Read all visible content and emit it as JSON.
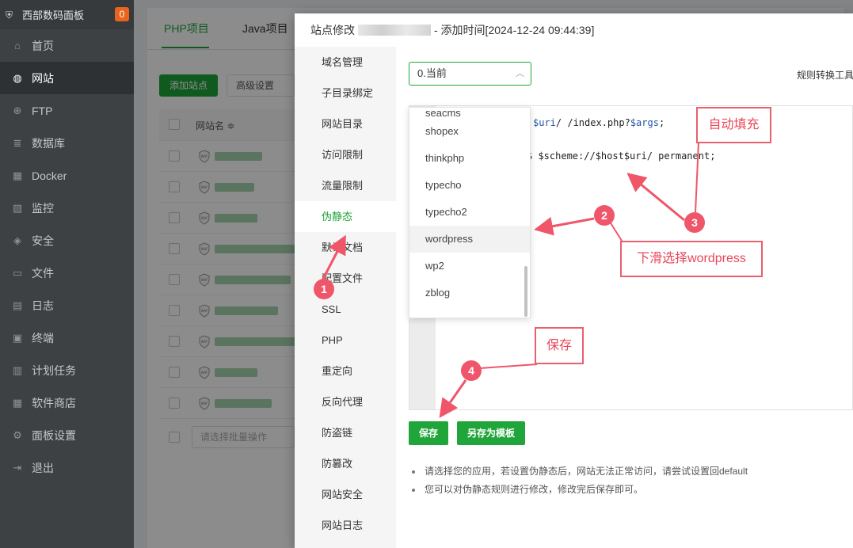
{
  "sidebar": {
    "brand": "西部数码面板",
    "badge": "0",
    "items": [
      {
        "label": "首页",
        "icon": "home-icon",
        "glyph": "⌂"
      },
      {
        "label": "网站",
        "icon": "globe-icon",
        "glyph": "◍"
      },
      {
        "label": "FTP",
        "icon": "ftp-icon",
        "glyph": "⊕"
      },
      {
        "label": "数据库",
        "icon": "database-icon",
        "glyph": "≣"
      },
      {
        "label": "Docker",
        "icon": "docker-icon",
        "glyph": "▦"
      },
      {
        "label": "监控",
        "icon": "monitor-icon",
        "glyph": "▨"
      },
      {
        "label": "安全",
        "icon": "shield-icon",
        "glyph": "◈"
      },
      {
        "label": "文件",
        "icon": "folder-icon",
        "glyph": "▭"
      },
      {
        "label": "日志",
        "icon": "log-icon",
        "glyph": "▤"
      },
      {
        "label": "终端",
        "icon": "terminal-icon",
        "glyph": "▣"
      },
      {
        "label": "计划任务",
        "icon": "calendar-icon",
        "glyph": "▥"
      },
      {
        "label": "软件商店",
        "icon": "apps-icon",
        "glyph": "▦"
      },
      {
        "label": "面板设置",
        "icon": "gear-icon",
        "glyph": "⚙"
      },
      {
        "label": "退出",
        "icon": "logout-icon",
        "glyph": "⇥"
      }
    ],
    "active_index": 1
  },
  "main": {
    "tabs": [
      "PHP项目",
      "Java项目"
    ],
    "add_site": "添加站点",
    "advanced": "高级设置",
    "col_site_name": "网站名 ≑",
    "bulk_placeholder": "请选择批量操作"
  },
  "dialog": {
    "title_prefix": "站点修改",
    "title_suffix": "- 添加时间[2024-12-24 09:44:39]",
    "menu": [
      "域名管理",
      "子目录绑定",
      "网站目录",
      "访问限制",
      "流量限制",
      "伪静态",
      "默认文档",
      "配置文件",
      "SSL",
      "PHP",
      "重定向",
      "反向代理",
      "防盗链",
      "防篡改",
      "网站安全",
      "网站日志"
    ],
    "active_menu_index": 5,
    "select_value": "0.当前",
    "tool_link": "规则转换工具",
    "code_line1_pre": "",
    "code_line1_var1": "$uri",
    "code_line1_mid": "/ /index.php?",
    "code_line1_var2": "$args",
    "code_line1_end": ";",
    "code_line2": "$scheme://$host$uri/ permanent;",
    "dropdown": [
      "seacms",
      "shopex",
      "thinkphp",
      "typecho",
      "typecho2",
      "wordpress",
      "wp2",
      "zblog"
    ],
    "hover_option": "wordpress",
    "save": "保存",
    "save_template": "另存为模板",
    "notes": [
      "请选择您的应用，若设置伪静态后，网站无法正常访问，请尝试设置回default",
      "您可以对伪静态规则进行修改，修改完后保存即可。"
    ]
  },
  "annotations": {
    "callout_autofill": "自动填充",
    "callout_scroll": "下滑选择wordpress",
    "callout_save": "保存",
    "step1": "1",
    "step2": "2",
    "step3": "3",
    "step4": "4",
    "color": "#f0566a"
  },
  "colors": {
    "accent": "#20a53a",
    "sidebar_bg": "#3d4144",
    "badge": "#e9641c"
  }
}
